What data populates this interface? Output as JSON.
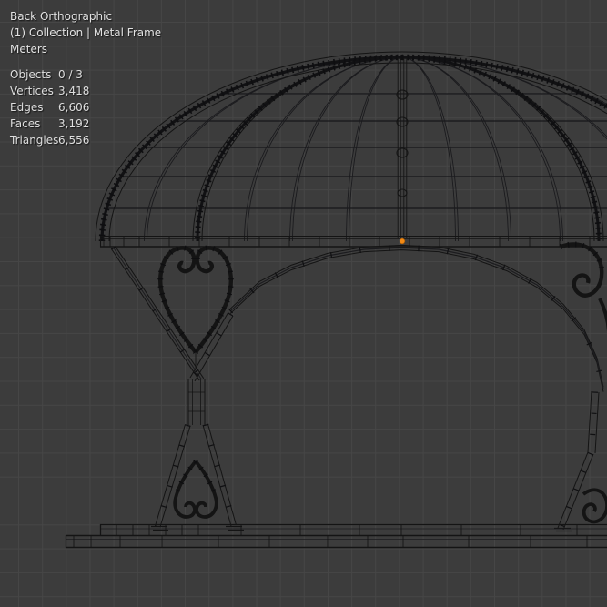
{
  "viewport": {
    "header": {
      "view": "Back Orthographic",
      "collection": "(1) Collection | Metal Frame",
      "units": "Meters"
    },
    "stats": [
      {
        "label": "Objects",
        "value": "0 / 3"
      },
      {
        "label": "Vertices",
        "value": "3,418"
      },
      {
        "label": "Edges",
        "value": "6,606"
      },
      {
        "label": "Faces",
        "value": "3,192"
      },
      {
        "label": "Triangles",
        "value": "6,556"
      }
    ],
    "colors": {
      "background": "#3c3c3c",
      "grid_line": "#464646",
      "wireframe": "#141414",
      "overlay_text": "#e2e2e2",
      "origin_marker": "#f28a16"
    }
  }
}
